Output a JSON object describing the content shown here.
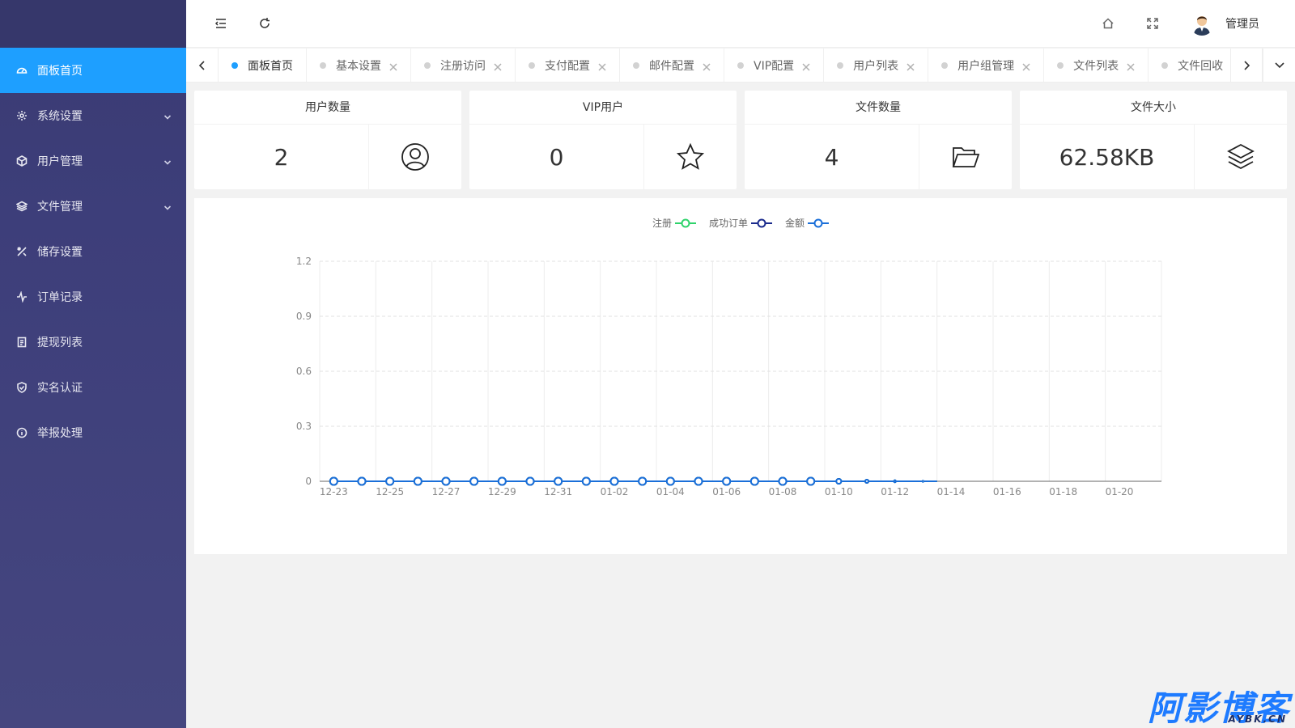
{
  "sidebar": {
    "items": [
      {
        "label": "面板首页",
        "icon": "dashboard-icon",
        "active": true,
        "has_children": false
      },
      {
        "label": "系统设置",
        "icon": "gear-icon",
        "active": false,
        "has_children": true
      },
      {
        "label": "用户管理",
        "icon": "cube-icon",
        "active": false,
        "has_children": true
      },
      {
        "label": "文件管理",
        "icon": "layers-icon",
        "active": false,
        "has_children": true
      },
      {
        "label": "储存设置",
        "icon": "tools-icon",
        "active": false,
        "has_children": false
      },
      {
        "label": "订单记录",
        "icon": "pulse-icon",
        "active": false,
        "has_children": false
      },
      {
        "label": "提现列表",
        "icon": "list-doc-icon",
        "active": false,
        "has_children": false
      },
      {
        "label": "实名认证",
        "icon": "shield-check-icon",
        "active": false,
        "has_children": false
      },
      {
        "label": "举报处理",
        "icon": "info-icon",
        "active": false,
        "has_children": false
      }
    ]
  },
  "header": {
    "username": "管理员",
    "icons": [
      "menu-collapse-icon",
      "refresh-icon",
      "home-icon",
      "fullscreen-icon",
      "avatar"
    ]
  },
  "tabs": [
    {
      "label": "面板首页",
      "active": true,
      "closable": false
    },
    {
      "label": "基本设置",
      "active": false,
      "closable": true
    },
    {
      "label": "注册访问",
      "active": false,
      "closable": true
    },
    {
      "label": "支付配置",
      "active": false,
      "closable": true
    },
    {
      "label": "邮件配置",
      "active": false,
      "closable": true
    },
    {
      "label": "VIP配置",
      "active": false,
      "closable": true
    },
    {
      "label": "用户列表",
      "active": false,
      "closable": true
    },
    {
      "label": "用户组管理",
      "active": false,
      "closable": true
    },
    {
      "label": "文件列表",
      "active": false,
      "closable": true
    },
    {
      "label": "文件回收",
      "active": false,
      "closable": true
    }
  ],
  "stats": [
    {
      "title": "用户数量",
      "value": "2",
      "icon": "user-circle-icon"
    },
    {
      "title": "VIP用户",
      "value": "0",
      "icon": "star-icon"
    },
    {
      "title": "文件数量",
      "value": "4",
      "icon": "folder-open-icon"
    },
    {
      "title": "文件大小",
      "value": "62.58KB",
      "icon": "layers-icon"
    }
  ],
  "colors": {
    "sidebar_bg": "#3d3e7a",
    "active_blue": "#1e9fff",
    "series_register": "#2fd36b",
    "series_orders": "#1a2a8c",
    "series_amount": "#1a6fd9"
  },
  "chart_data": {
    "type": "line",
    "x": [
      "12-23",
      "12-24",
      "12-25",
      "12-26",
      "12-27",
      "12-28",
      "12-29",
      "12-30",
      "12-31",
      "01-01",
      "01-02",
      "01-03",
      "01-04",
      "01-05",
      "01-06",
      "01-07",
      "01-08",
      "01-09",
      "01-10",
      "01-11",
      "01-12",
      "01-13",
      "01-14",
      "01-15",
      "01-16",
      "01-17",
      "01-18",
      "01-19",
      "01-20",
      "01-21"
    ],
    "x_tick_labels": [
      "12-23",
      "12-25",
      "12-27",
      "12-29",
      "12-31",
      "01-02",
      "01-04",
      "01-06",
      "01-08",
      "01-10",
      "01-12",
      "01-14",
      "01-16",
      "01-18",
      "01-20"
    ],
    "ylim": [
      0,
      1.2
    ],
    "y_ticks": [
      "0",
      "0.3",
      "0.6",
      "0.9",
      "1.2"
    ],
    "grid": true,
    "legend_position": "top-center",
    "series": [
      {
        "name": "注册",
        "color": "#2fd36b",
        "values": [
          0,
          0,
          0,
          0,
          0,
          0,
          0,
          0,
          0,
          0,
          0,
          0,
          0,
          0,
          0,
          0,
          0,
          0,
          0,
          0,
          0,
          0
        ]
      },
      {
        "name": "成功订单",
        "color": "#1a2a8c",
        "values": [
          0,
          0,
          0,
          0,
          0,
          0,
          0,
          0,
          0,
          0,
          0,
          0,
          0,
          0,
          0,
          0,
          0,
          0,
          0,
          0,
          0,
          0
        ]
      },
      {
        "name": "金额",
        "color": "#1a6fd9",
        "values": [
          0,
          0,
          0,
          0,
          0,
          0,
          0,
          0,
          0,
          0,
          0,
          0,
          0,
          0,
          0,
          0,
          0,
          0,
          0,
          0,
          0,
          0
        ]
      }
    ]
  },
  "watermark": {
    "big": "阿影博客",
    "small": "AYBK.CN"
  }
}
